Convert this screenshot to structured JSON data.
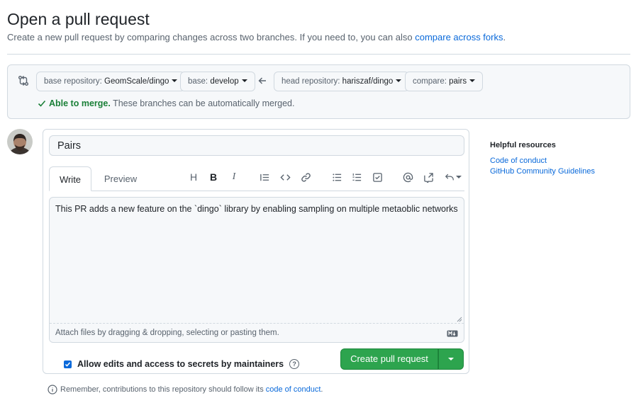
{
  "header": {
    "title": "Open a pull request",
    "description": "Create a new pull request by comparing changes across two branches. If you need to, you can also ",
    "forks_link": "compare across forks",
    "description_end": "."
  },
  "compare": {
    "base_repo_label": "base repository:",
    "base_repo_value": "GeomScale/dingo",
    "base_label": "base:",
    "base_value": "develop",
    "head_repo_label": "head repository:",
    "head_repo_value": "hariszaf/dingo",
    "compare_label": "compare:",
    "compare_value": "pairs",
    "merge_ok": "Able to merge.",
    "merge_text": "These branches can be automatically merged."
  },
  "form": {
    "title_value": "Pairs",
    "tabs": {
      "write": "Write",
      "preview": "Preview"
    },
    "body_text": "This PR adds a new feature on the `dingo` library by enabling sampling on multiple metaoblic networks",
    "attach_hint": "Attach files by dragging & dropping, selecting or pasting them.",
    "allow_edits": "Allow edits and access to secrets by maintainers",
    "allow_checked": true,
    "create_button": "Create pull request"
  },
  "toolbar": {
    "heading": "H",
    "bold": "B",
    "italic": "I"
  },
  "sidebar": {
    "heading": "Helpful resources",
    "links": [
      "Code of conduct",
      "GitHub Community Guidelines"
    ]
  },
  "footer": {
    "remember": "Remember, contributions to this repository should follow its ",
    "conduct_link": "code of conduct",
    "remember_end": "."
  },
  "colors": {
    "accent": "#0969da",
    "success": "#1a7f37",
    "button_green": "#2da44e",
    "border": "#d1d9e0"
  }
}
